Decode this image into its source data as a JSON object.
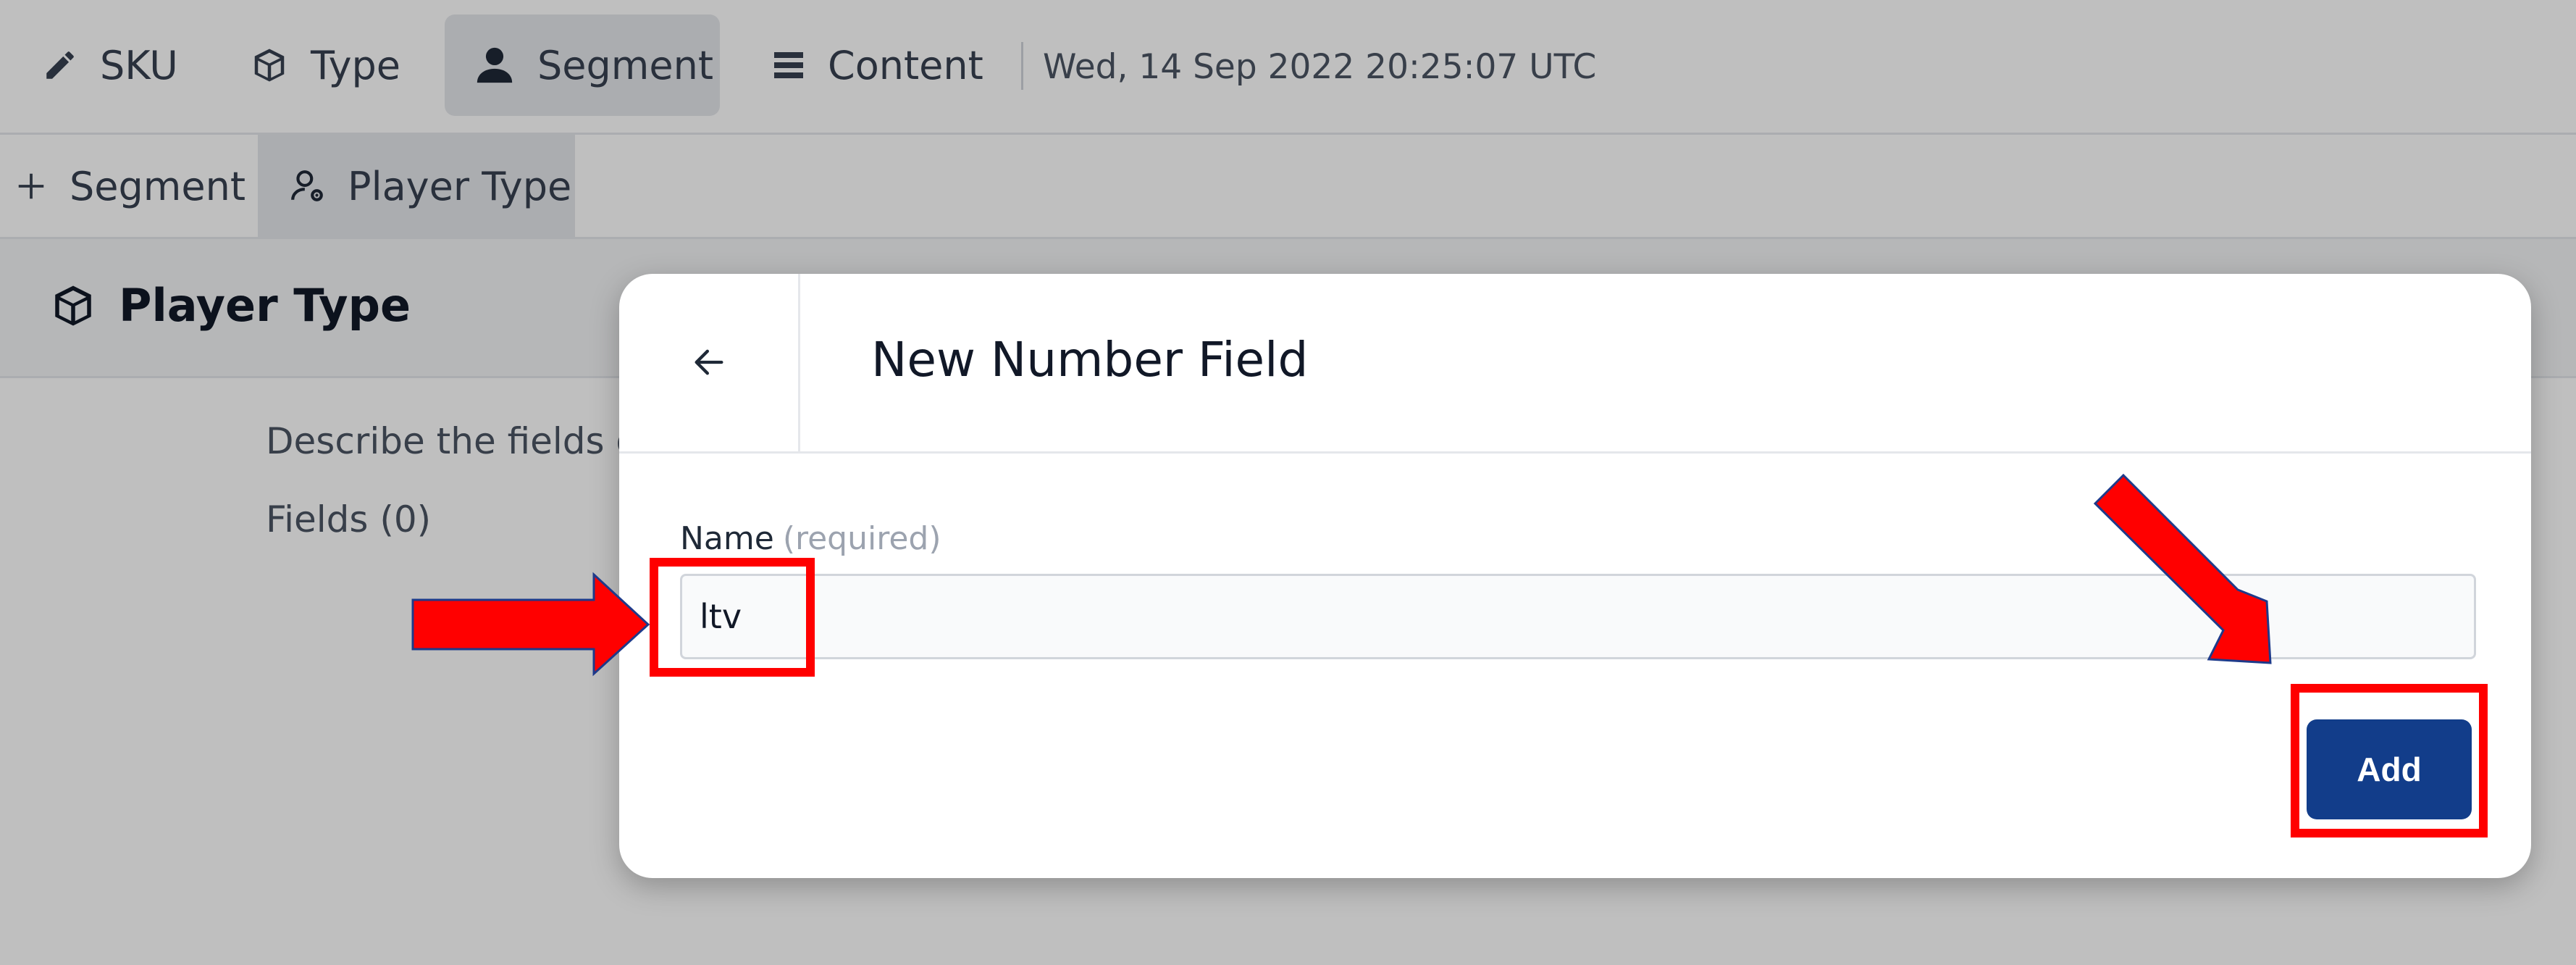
{
  "topnav": {
    "items": [
      {
        "label": "SKU",
        "icon": "pencil-icon"
      },
      {
        "label": "Type",
        "icon": "cube-icon"
      },
      {
        "label": "Segment",
        "icon": "user-icon",
        "active": true
      },
      {
        "label": "Content",
        "icon": "list-icon"
      }
    ],
    "timestamp": "Wed, 14 Sep 2022 20:25:07 UTC"
  },
  "subnav": {
    "items": [
      {
        "label": "Segment",
        "icon": "plus-icon"
      },
      {
        "label": "Player Type",
        "icon": "user-gear-icon",
        "active": true
      }
    ]
  },
  "page": {
    "title": "Player Type",
    "title_icon": "cube-icon",
    "description": "Describe the fields o",
    "fields_count": "Fields (0)"
  },
  "modal": {
    "title": "New Number Field",
    "back_icon": "arrow-left-icon",
    "name_label": "Name",
    "name_required": "(required)",
    "name_value": "ltv",
    "add_label": "Add"
  },
  "colors": {
    "primary_button": "#123d8a",
    "annotation": "#ff0000"
  }
}
